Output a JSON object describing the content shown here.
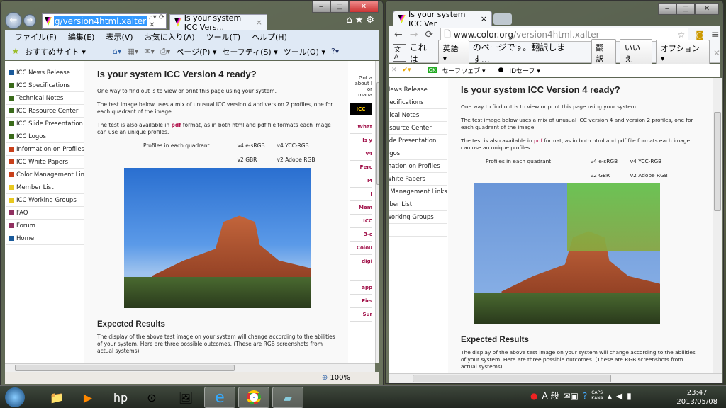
{
  "ie": {
    "address": "g/version4html.xalter",
    "tab_title": "Is your system ICC Vers...",
    "menu": [
      "ファイル(F)",
      "編集(E)",
      "表示(V)",
      "お気に入り(A)",
      "ツール(T)",
      "ヘルプ(H)"
    ],
    "favorites": "おすすめサイト ▾",
    "cmd": [
      "ページ(P) ▾",
      "セーフティ(S) ▾",
      "ツール(O) ▾"
    ],
    "zoom": "100%",
    "right_col": [
      "Got a",
      "about I",
      "or",
      "mana",
      "ICC",
      "What",
      "Is y",
      "v4",
      "Perc",
      "M",
      "I",
      "Mem",
      "ICC",
      "3-c",
      "Colou",
      "digi",
      "",
      "app",
      "Firs",
      "Sur"
    ]
  },
  "nav": [
    {
      "label": "ICC News Release",
      "color": "#1a5a9a"
    },
    {
      "label": "ICC Specifications",
      "color": "#3a6a1a"
    },
    {
      "label": "Technical Notes",
      "color": "#3a6a1a"
    },
    {
      "label": "ICC Resource Center",
      "color": "#3a6a1a"
    },
    {
      "label": "ICC Slide Presentation",
      "color": "#3a6a1a"
    },
    {
      "label": "ICC Logos",
      "color": "#3a6a1a"
    },
    {
      "label": "Information on Profiles",
      "color": "#c8401a"
    },
    {
      "label": "ICC White Papers",
      "color": "#c8401a"
    },
    {
      "label": "Color Management Links",
      "color": "#c8401a"
    },
    {
      "label": "Member List",
      "color": "#e8c820"
    },
    {
      "label": "ICC Working Groups",
      "color": "#e8c820"
    },
    {
      "label": "FAQ",
      "color": "#903060"
    },
    {
      "label": "Forum",
      "color": "#903060"
    },
    {
      "label": "Home",
      "color": "#1a5a9a"
    }
  ],
  "page": {
    "title": "Is your system ICC Version 4 ready?",
    "p1": "One way to find out is to view or print this page using your system.",
    "p2": "The test image below uses a mix of unusual ICC version 4 and version 2 profiles, one for each quadrant of the image.",
    "p3a": "The test is also available in ",
    "pdf": "pdf",
    "p3b": " format, as in both html and pdf file formats each image can use an unique profiles.",
    "prof_label": "Profiles in each quadrant:",
    "q1": "v4 e-sRGB",
    "q2": "v4 YCC-RGB",
    "q3": "v2 GBR",
    "q4": "v2 Adobe RGB",
    "h2": "Expected Results",
    "p4": "The display of the above test image on your system will change according to the abilities of your system. Here are three possible outcomes. (These are RGB screenshots from actual systems)"
  },
  "chrome": {
    "tab_title": "Is your system ICC Ver",
    "url_host": "www.color.org",
    "url_path": "/version4html.xalter",
    "translate_pre": "これは",
    "lang": "英語 ▾",
    "translate_post": "のページです。翻訳します…",
    "translate_btn": "翻訳",
    "no_btn": "いいえ",
    "options_btn": "オプション ▾",
    "ext1": "セーフウェブ ▾",
    "ext2": "IDセーフ ▾",
    "nav_cut": [
      "News Release",
      "pecifications",
      "nical Notes",
      "esource Center",
      "lide Presentation",
      "ogos",
      "mation on Profiles",
      "White Papers",
      "r Management Links",
      "nber List",
      "Working Groups",
      "",
      "e"
    ]
  },
  "tray": {
    "time": "23:47",
    "date": "2013/05/08",
    "ime": "A 般",
    "caps": "CAPS",
    "kana": "KANA"
  }
}
